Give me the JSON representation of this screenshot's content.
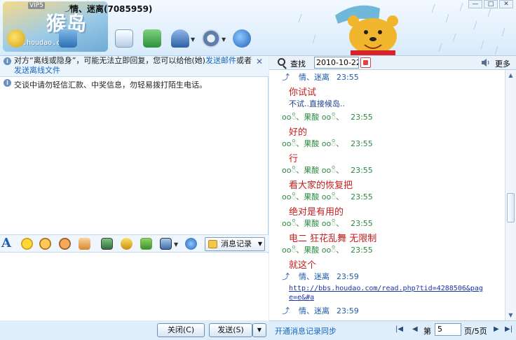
{
  "window": {
    "title": "情、迷离(7085959)",
    "title_tag": "VIP5",
    "logo_big": "猴岛",
    "logo_url": "bbs.houdao.com"
  },
  "toolbar": {
    "icons": [
      "video-call-icon",
      "audio-call-icon",
      "send-file-icon",
      "add-app-icon",
      "contact-info-icon",
      "settings-icon",
      "qzone-icon"
    ]
  },
  "left": {
    "offline_notice": {
      "prefix": "对方“离线或隐身”，可能无法立即回复，您可以给他(她)",
      "link1": "发送邮件",
      "mid": "或者",
      "link2": "发送离线文件"
    },
    "warning": "交谈中请勿轻信汇款、中奖信息，勿轻易拨打陌生电话。",
    "history_button": "消息记录",
    "close_button": "关闭(C)",
    "send_button": "发送(S)"
  },
  "right": {
    "search_label": "查找",
    "date_value": "2010-10-22",
    "more_label": "更多",
    "messages": [
      {
        "kind": "h-b",
        "who": "情、迷离",
        "time": "23:55"
      },
      {
        "kind": "t-r",
        "text": "你试试"
      },
      {
        "kind": "t-b",
        "text": "不试..直接候岛.."
      },
      {
        "kind": "h-g",
        "who": "ooိ、果酸 ooိ、",
        "time": "23:55"
      },
      {
        "kind": "t-r",
        "text": "好的"
      },
      {
        "kind": "h-g",
        "who": "ooိ、果酸 ooိ、",
        "time": "23:55"
      },
      {
        "kind": "t-r",
        "text": "行"
      },
      {
        "kind": "h-g",
        "who": "ooိ、果酸 ooိ、",
        "time": "23:55"
      },
      {
        "kind": "t-r",
        "text": "看大家的恢复把"
      },
      {
        "kind": "h-g",
        "who": "ooိ、果酸 ooိ、",
        "time": "23:55"
      },
      {
        "kind": "t-r",
        "text": "绝对是有用的"
      },
      {
        "kind": "h-g",
        "who": "ooိ、果酸 ooိ、",
        "time": "23:55"
      },
      {
        "kind": "t-r",
        "text": "电二  狂花乱舞  无限制"
      },
      {
        "kind": "h-g",
        "who": "ooိ、果酸 ooိ、",
        "time": "23:55"
      },
      {
        "kind": "t-r",
        "text": "就这个"
      },
      {
        "kind": "h-b",
        "who": "情、迷离",
        "time": "23:59"
      },
      {
        "kind": "t-url",
        "line1": "http://bbs.houdao.com/read.php?tid=4288506&pag",
        "line2": "e=e&#a"
      },
      {
        "kind": "h-b",
        "who": "情、迷离",
        "time": "23:59"
      }
    ],
    "sync_link": "开通消息记录同步",
    "page_prefix": "第",
    "page_value": "5",
    "page_suffix": "页/5页"
  }
}
